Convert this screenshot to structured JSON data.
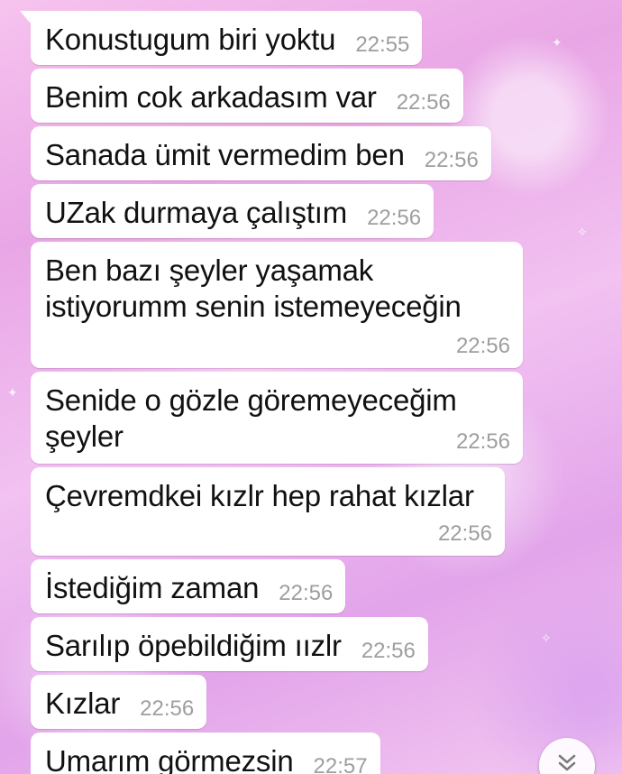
{
  "messages": [
    {
      "text": "Konustugum biri yoktu",
      "time": "22:55"
    },
    {
      "text": "Benim cok arkadasım var",
      "time": "22:56"
    },
    {
      "text": "Sanada ümit vermedim ben",
      "time": "22:56"
    },
    {
      "text": "UZak durmaya çalıştım",
      "time": "22:56"
    },
    {
      "text": "Ben bazı şeyler yaşamak\nistiyorumm senin istemeyeceğin",
      "time": "22:56"
    },
    {
      "text": "Senide o gözle göremeyeceğim\nşeyler",
      "time": "22:56"
    },
    {
      "text": "Çevremdkei kızlr hep rahat kızlar",
      "time": "22:56"
    },
    {
      "text": "İstediğim zaman",
      "time": "22:56"
    },
    {
      "text": "Sarılıp öpebildiğim ıızlr",
      "time": "22:56"
    },
    {
      "text": "Kızlar",
      "time": "22:56"
    },
    {
      "text": "Umarım görmezsin",
      "time": "22:57"
    }
  ],
  "scroll_button": {
    "icon": "double-chevron-down-icon"
  }
}
